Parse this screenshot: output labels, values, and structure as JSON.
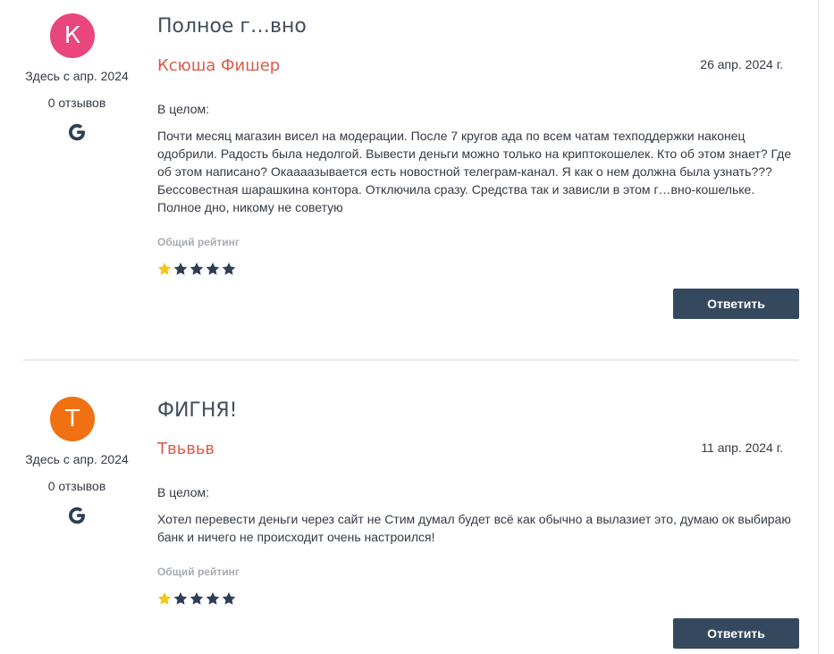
{
  "reviews": [
    {
      "avatar_letter": "К",
      "avatar_color": "#e8467c",
      "member_since": "Здесь с апр. 2024",
      "review_count": "0 отзывов",
      "source_icon": "google-g-icon",
      "title": "Полное г…вно",
      "author": "Ксюша Фишер",
      "date": "26 апр. 2024 г.",
      "overall_label": "В целом:",
      "text": "Почти месяц магазин висел на модерации. После 7 кругов ада по всем чатам техподдержки наконец одобрили. Радость была недолгой. Вывести деньги можно только на криптокошелек. Кто об этом знает? Где об этом написано? Окаааазывается есть новостной телеграм-канал. Я как о нем должна была узнать??? Бессовестная шарашкина контора. Отключила сразу. Средства так и зависли в этом г…вно-кошельке. Полное дно, никому не советую",
      "rating_label": "Общий рейтинг",
      "rating": 1,
      "rating_max": 5,
      "reply_label": "Ответить"
    },
    {
      "avatar_letter": "Т",
      "avatar_color": "#f07012",
      "member_since": "Здесь с апр. 2024",
      "review_count": "0 отзывов",
      "source_icon": "google-g-icon",
      "title": "ФИГНЯ!",
      "author": "Твьвьв",
      "date": "11 апр. 2024 г.",
      "overall_label": "В целом:",
      "text": "Хотел перевести деньги через сайт не Стим думал будет всё как обычно а вылазиет это, думаю ок выбираю банк и ничего не происходит очень настроился!",
      "rating_label": "Общий рейтинг",
      "rating": 1,
      "rating_max": 5,
      "reply_label": "Ответить"
    }
  ],
  "colors": {
    "star_filled": "#f5c518",
    "star_empty": "#2d3d56",
    "button_bg": "#34495e",
    "author": "#d95b4a"
  }
}
